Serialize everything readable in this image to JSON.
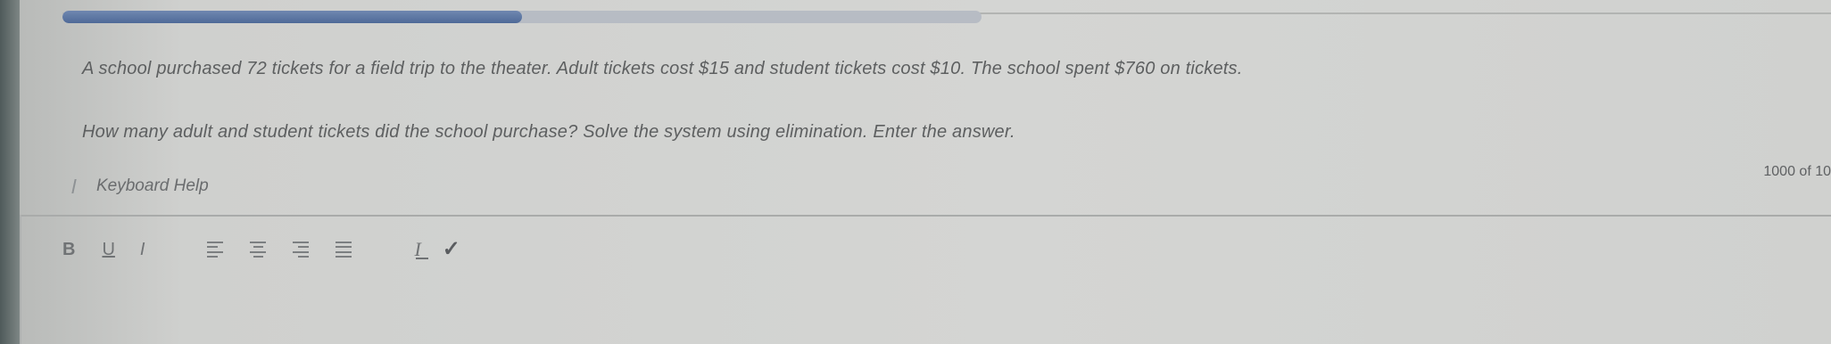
{
  "progress": {
    "fraction": 0.5
  },
  "question": {
    "line1": "A school purchased 72 tickets for a field trip to the theater. Adult tickets cost $15 and student tickets cost $10. The school spent $760 on tickets.",
    "line2": "How many adult and student tickets did the school purchase? Solve the system using elimination. Enter the answer."
  },
  "keyboard_help": {
    "label": "Keyboard Help",
    "icon": "keyboard-help-icon"
  },
  "char_count": "1000 of 10",
  "toolbar": {
    "bold": "B",
    "underline": "U",
    "italic": "I",
    "align_left_icon": "align-left-icon",
    "align_center_icon": "align-center-icon",
    "align_right_icon": "align-right-icon",
    "align_justify_icon": "align-justify-icon",
    "clear_format": "I",
    "spellcheck": "✓"
  }
}
